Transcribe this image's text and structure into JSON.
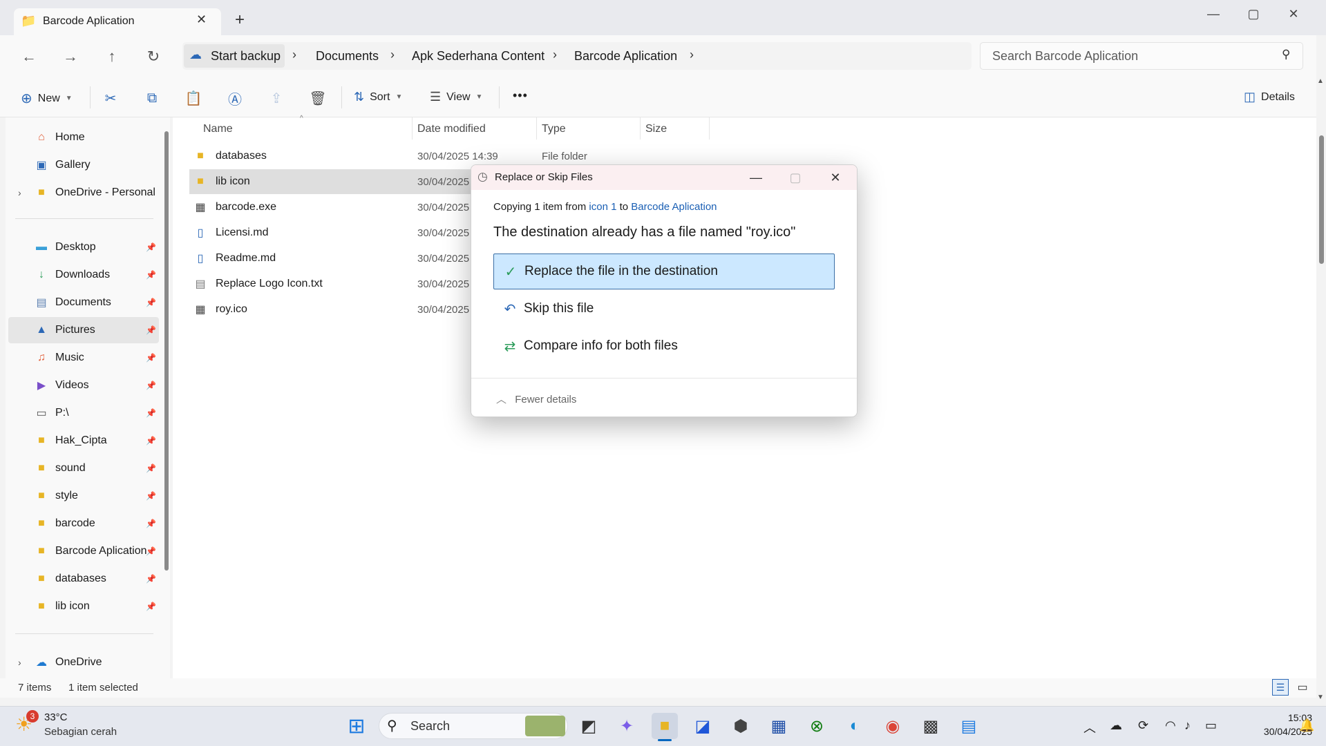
{
  "window": {
    "tab_title": "Barcode Aplication",
    "new_tab": "+"
  },
  "address": {
    "backup": "Start backup",
    "crumbs": [
      "Documents",
      "Apk Sederhana Content",
      "Barcode Aplication"
    ],
    "search_placeholder": "Search Barcode Aplication"
  },
  "commands": {
    "new": "New",
    "sort": "Sort",
    "view": "View",
    "more": "•••",
    "details": "Details"
  },
  "nav": {
    "top": [
      "Home",
      "Gallery",
      "OneDrive - Personal"
    ],
    "pinned": [
      "Desktop",
      "Downloads",
      "Documents",
      "Pictures",
      "Music",
      "Videos",
      "P:\\",
      "Hak_Cipta",
      "sound",
      "style",
      "barcode",
      "Barcode Aplication",
      "databases",
      "lib icon"
    ],
    "bottom": [
      "OneDrive"
    ]
  },
  "columns": [
    "Name",
    "Date modified",
    "Type",
    "Size"
  ],
  "files": [
    {
      "name": "databases",
      "date": "30/04/2025 14:39",
      "type": "File folder",
      "icon": "folder-icon"
    },
    {
      "name": "lib icon",
      "date": "30/04/2025",
      "type": "",
      "icon": "folder-icon"
    },
    {
      "name": "barcode.exe",
      "date": "30/04/2025",
      "type": "",
      "icon": "exe-icon"
    },
    {
      "name": "Licensi.md",
      "date": "30/04/2025",
      "type": "",
      "icon": "md-icon"
    },
    {
      "name": "Readme.md",
      "date": "30/04/2025",
      "type": "",
      "icon": "md-icon"
    },
    {
      "name": "Replace Logo Icon.txt",
      "date": "30/04/2025",
      "type": "",
      "icon": "txt-icon"
    },
    {
      "name": "roy.ico",
      "date": "30/04/2025",
      "type": "",
      "icon": "ico-icon"
    }
  ],
  "status": {
    "count": "7 items",
    "selected": "1 item selected"
  },
  "dialog": {
    "title": "Replace or Skip Files",
    "copying_prefix": "Copying 1 item from",
    "source": "icon 1",
    "to": "to",
    "destination": "Barcode Aplication",
    "heading": "The destination already has a file named \"roy.ico\"",
    "options": [
      "Replace the file in the destination",
      "Skip this file",
      "Compare info for both files"
    ],
    "fewer": "Fewer details"
  },
  "taskbar": {
    "weather_badge": "3",
    "temp": "33°C",
    "weather": "Sebagian cerah",
    "search": "Search",
    "time": "15:03",
    "date": "30/04/2025"
  },
  "colors": {
    "accent": "#0067c0",
    "selected_option": "#cce8ff",
    "folder": "#f4c542"
  }
}
